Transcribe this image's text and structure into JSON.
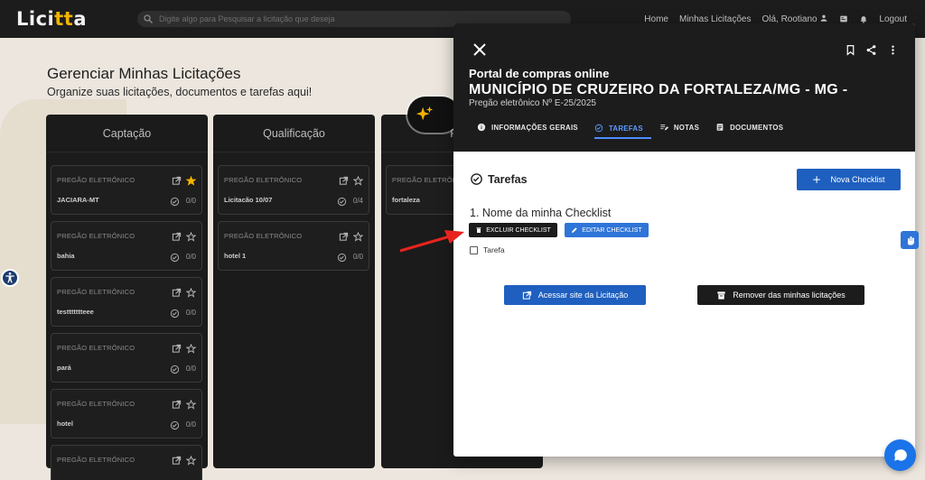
{
  "app": {
    "logo_main": "Lici",
    "logo_accent": "tt",
    "logo_end": "a"
  },
  "search": {
    "placeholder": "Digite algo para Pesquisar a licitação que deseja"
  },
  "topnav": {
    "home": "Home",
    "minhas": "Minhas Licitações",
    "greeting": "Olá, Rootiano",
    "logout": "Logout"
  },
  "page": {
    "title": "Gerenciar Minhas Licitações",
    "subtitle": "Organize suas licitações, documentos e tarefas aqui!"
  },
  "columns": [
    {
      "title": "Captação"
    },
    {
      "title": "Qualificação"
    },
    {
      "title": "Prep"
    }
  ],
  "cards": {
    "captacao": [
      {
        "kind": "PREGÃO ELETRÔNICO",
        "name": "JACIARA-MT",
        "count": "0/0",
        "starred": true
      },
      {
        "kind": "PREGÃO ELETRÔNICO",
        "name": "bahia",
        "count": "0/0",
        "starred": false
      },
      {
        "kind": "PREGÃO ELETRÔNICO",
        "name": "testtttttteee",
        "count": "0/0",
        "starred": false
      },
      {
        "kind": "PREGÃO ELETRÔNICO",
        "name": "pará",
        "count": "0/0",
        "starred": false
      },
      {
        "kind": "PREGÃO ELETRÔNICO",
        "name": "hotel",
        "count": "0/0",
        "starred": false
      },
      {
        "kind": "PREGÃO ELETRÔNICO",
        "name": "",
        "count": "",
        "starred": false
      }
    ],
    "qualificacao": [
      {
        "kind": "PREGÃO ELETRÔNICO",
        "name": "Licitacão 10/07",
        "count": "0/4",
        "starred": false
      },
      {
        "kind": "PREGÃO ELETRÔNICO",
        "name": "hotel 1",
        "count": "0/0",
        "starred": false
      }
    ],
    "preparacao": [
      {
        "kind": "PREGÃO ELETRÔNICO",
        "name": "fortaleza"
      }
    ]
  },
  "drawer": {
    "title1": "Portal de compras online",
    "title2": "MUNICÍPIO DE CRUZEIRO DA FORTALEZA/MG - MG -",
    "title3": "Pregão eletrônico Nº E-25/2025",
    "tabs": [
      {
        "label": "INFORMAÇÕES GERAIS",
        "icon": "info-icon"
      },
      {
        "label": "TAREFAS",
        "icon": "check-circle-icon",
        "active": true
      },
      {
        "label": "NOTAS",
        "icon": "notes-icon"
      },
      {
        "label": "DOCUMENTOS",
        "icon": "document-icon"
      }
    ],
    "section_title": "Tarefas",
    "nova_checklist": "Nova Checklist",
    "checklist_title": "1. Nome da minha Checklist",
    "excluir": "EXCLUIR CHECKLIST",
    "editar": "EDITAR CHECKLIST",
    "task": "Tarefa",
    "acessar": "Acessar site da Licitação",
    "remover": "Remover das minhas licitações"
  },
  "colors": {
    "primary": "#1f5fbf",
    "dark": "#1c1c1c",
    "star": "#f2b400",
    "arrow": "#e8231e"
  }
}
